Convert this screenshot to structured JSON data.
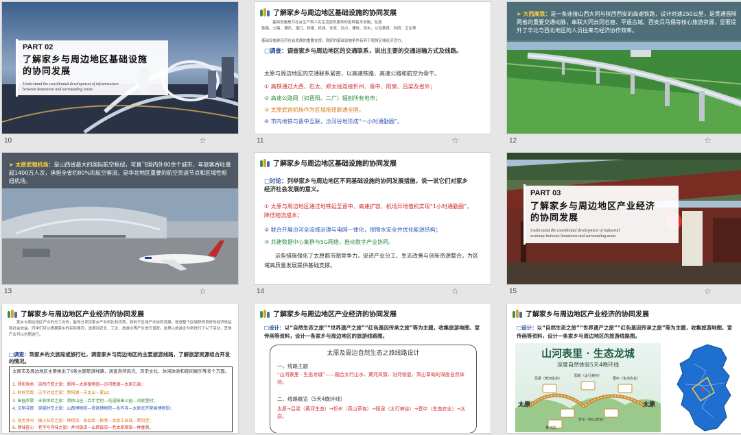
{
  "slides": [
    {
      "num": "10",
      "part": "PART 02",
      "title_l1": "了解家乡与周边地区基础设施",
      "title_l2": "的协同发展",
      "en_l1": "Understand the coordinated development of infrastructure",
      "en_l2": "between hometown and surrounding areas"
    },
    {
      "num": "11",
      "header": "了解家乡与周边地区基础设施的协同发展",
      "intro_l1": "基础设施是为社会生产和人民生活提供服务的各种基本设施，包括",
      "intro_hl": "铁路、公路、通讯、港口、桥梁、机场、仓库、动力、通信、供水，以及教育、科研、卫生等",
      "intro_l3": "基础设施是经济社会发展的重要支撑，良好的基础设施条件有利于增强区域经济活力。",
      "survey_label": "调查：",
      "survey_text": "调查家乡与周边地区的交通联系，说出主要的交通运输方式及线路。",
      "lead": "太原与周边地区的交通联系紧密，以高速铁路、高速公路和航空为骨干。",
      "items": [
        "① 高铁通过大西、石太、郑太线连接忻州、晋中、阳泉、吕梁及省外；",
        "② 高速公路网（如晋阳、二广）辐射所有地市；",
        "③ 太原武宿机场作为区域枢纽联通全国。",
        "④ 市内地铁与晋中互联，汾河谷地形成“一小时通勤圈”。"
      ]
    },
    {
      "num": "12",
      "hl": "大西高铁：",
      "text": "是一条连接山西大同与陕西西安的高速铁路，设计时速250公里，是贯通晋陕两省的重要交通动脉，串联大同云冈石窟、平遥古城、西安兵马俑等核心旅游资源，显著提升了华北与西北地区的人员往来与经济协作效率。"
    },
    {
      "num": "13",
      "hl": "太原武宿机场：",
      "text": "是山西省最大的国际航空枢纽，可直飞国内外80余个城市，年旅客吞吐量超1400万人次，承担全省约80%的航空客流，是华北地区重要的航空货运节点和区域性枢纽机场。"
    },
    {
      "num": "14",
      "header": "了解家乡与周边地区基础设施的协同发展",
      "discuss_label": "讨论：",
      "discuss_text": "列举家乡与周边地区不同基础设施的协同发展措施，说一说它们对家乡经济社会发展的意义。",
      "items": [
        "① 太原与周边地区通过地铁延至晋中、高速扩容、机场异地值机实现“1小时通勤圈”，降低物流成本；",
        "② 联合开展汾河全流域治理与电网一体化，保障水安全并优化能源结构；",
        "③ 共建数据中心集群与5G网络，推动数字产业协同。"
      ],
      "conclusion": "这些措施强化了太原都市圈竞争力，促进产业分工、生态改善与创新资源整合，为区域高质量发展提供基础支撑。"
    },
    {
      "num": "15",
      "part": "PART 03",
      "title_l1": "了解家乡与周边地区产业经济",
      "title_l2": "的协同发展",
      "en_l1": "Understand the coordinated development of industrial",
      "en_l2": "economy between hometown and surrounding areas"
    },
    {
      "num": "",
      "header": "了解家乡与周边地区产业经济的协同发展",
      "intro": "家乡与周边地区产业的分工合作，能充分发挥家乡产业的比较优势，有利于区域产业协同发展。促进整个区域获得良好的经济效益和社会效益。同学们可以根据家乡的实际情况，选择对农业、工业、旅游业等产业进行调查。这里以旅游业为例进行了以下活动，其他产业可以仿照进行。",
      "survey_label": "调查：",
      "survey_text": "到家乡的文旅局或旅行社，调查家乡与周边地区的主要旅游线路，了解旅游资源组合开发的情况。",
      "box_lead": "太原市及周边地区主要推出了6条主题旅游线路，涵盖自然风光、历史文化、休闲体验和夜间娱乐等多个方面。",
      "routes": [
        "1. 晋阳秋色 · 自然疗愈之旅：晋祠—太原植物园—汾河晚渡—太原古县；",
        "2. 醉秋觅踪 · 古今对话之旅：晋阳湖—天龙山—蒙山；",
        "3. 田园欢歌 · 丰收体验之旅：清徐山庄—百年老村—花语稻田公园—刘家堡村；",
        "4. 文明寻踪 · 穿越时空之旅：山西博物院—晋商博物院—永祚寺—太原北齐壁画博物馆；",
        "5. 夜色并州 · 烟火狂欢之旅：钟楼街、食品街—柳巷—太原古县城—晋阳里；",
        "6. 晋味匠心 · 老字号寻味之旅：并州饭店—山西饭店—老太原菜馆—林香斋。"
      ]
    },
    {
      "num": "",
      "header": "了解家乡与周边地区产业经济的协同发展",
      "design_label": "设计：",
      "design_text": "以“自然生态之旅”“世界遗产之旅”“红色基因传承之旅”等为主题，收集旅游地图、宣传画等资料，设计一条家乡与周边地区的旅游线路图。",
      "card_title": "太原及周边自然生态之旅线路设计",
      "sec1": "一、线路主题",
      "sec1_text": "“山河表里 · 生态龙城”——融合太行山水、黄河风情、汾河修复、高山草甸的深度自然体验。",
      "sec2": "二、线路概览（5天4晚环线）",
      "sec2_text": "太原→吕梁（黄河生态）→忻州（高山草甸）→阳泉（太行峡谷）→晋中（生态农业）→太原。"
    },
    {
      "num": "",
      "header": "了解家乡与周边地区产业经济的协同发展",
      "design_label": "设计：",
      "design_text": "以“自然生态之旅”“世界遗产之旅”“红色基因传承之旅”等为主题，收集旅游地图、宣传画等资料，设计一条家乡与周边地区的旅游线路图。",
      "poster_title": "山河表里 · 生态龙城",
      "poster_sub": "深度自然体验5天4晚环线",
      "places": [
        "吕梁（黄河生态）",
        "阳泉（太行峡谷）",
        "晋中（生态农业）",
        "忻州（高山草甸）",
        "太原",
        "太原",
        "黄河边"
      ]
    }
  ],
  "star_glyph": "☆"
}
